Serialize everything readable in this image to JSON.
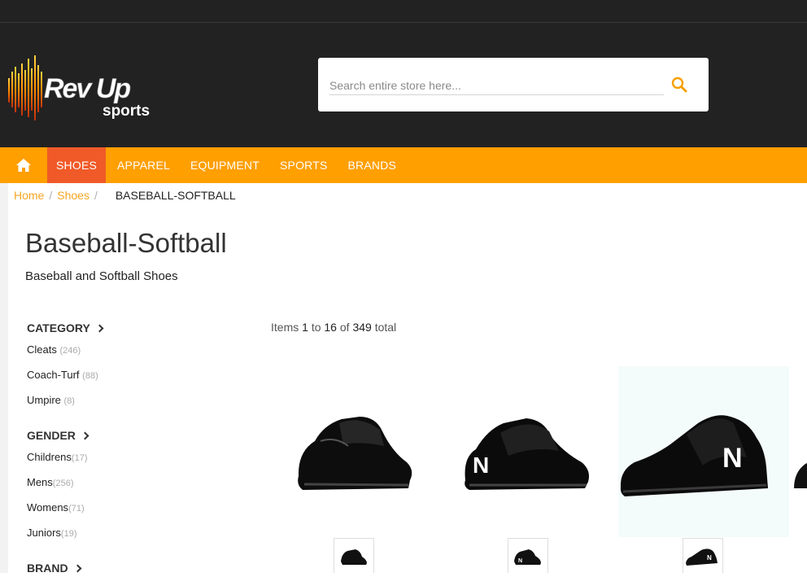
{
  "brand": {
    "logo_text_line1": "Rev Up",
    "logo_text_line2": "sports",
    "accent_color": "#ff9f00",
    "active_color": "#f05a28"
  },
  "search": {
    "placeholder": "Search entire store here...",
    "value": "",
    "icon": "search-icon"
  },
  "nav": {
    "home_icon": "home-icon",
    "items": [
      {
        "label": "SHOES",
        "active": true
      },
      {
        "label": "APPAREL",
        "active": false
      },
      {
        "label": "EQUIPMENT",
        "active": false
      },
      {
        "label": "SPORTS",
        "active": false
      },
      {
        "label": "BRANDS",
        "active": false
      }
    ]
  },
  "breadcrumb": {
    "home": "Home",
    "shoes": "Shoes",
    "current": "BASEBALL-SOFTBALL"
  },
  "page": {
    "title": "Baseball-Softball",
    "description": "Baseball and Softball Shoes"
  },
  "filters": {
    "category": {
      "title": "CATEGORY",
      "items": [
        {
          "label": "Cleats",
          "count": "(246)"
        },
        {
          "label": "Coach-Turf",
          "count": "(88)"
        },
        {
          "label": "Umpire",
          "count": "(8)"
        }
      ]
    },
    "gender": {
      "title": "GENDER",
      "items": [
        {
          "label": "Childrens",
          "count": "(17)"
        },
        {
          "label": "Mens",
          "count": "(256)"
        },
        {
          "label": "Womens",
          "count": "(71)"
        },
        {
          "label": "Juniors",
          "count": "(19)"
        }
      ]
    },
    "brand": {
      "title": "BRAND"
    }
  },
  "toolbar": {
    "items_label": "Items",
    "from": "1",
    "to_label": "to",
    "to": "16",
    "of_label": "of",
    "total": "349",
    "total_label": "total"
  }
}
